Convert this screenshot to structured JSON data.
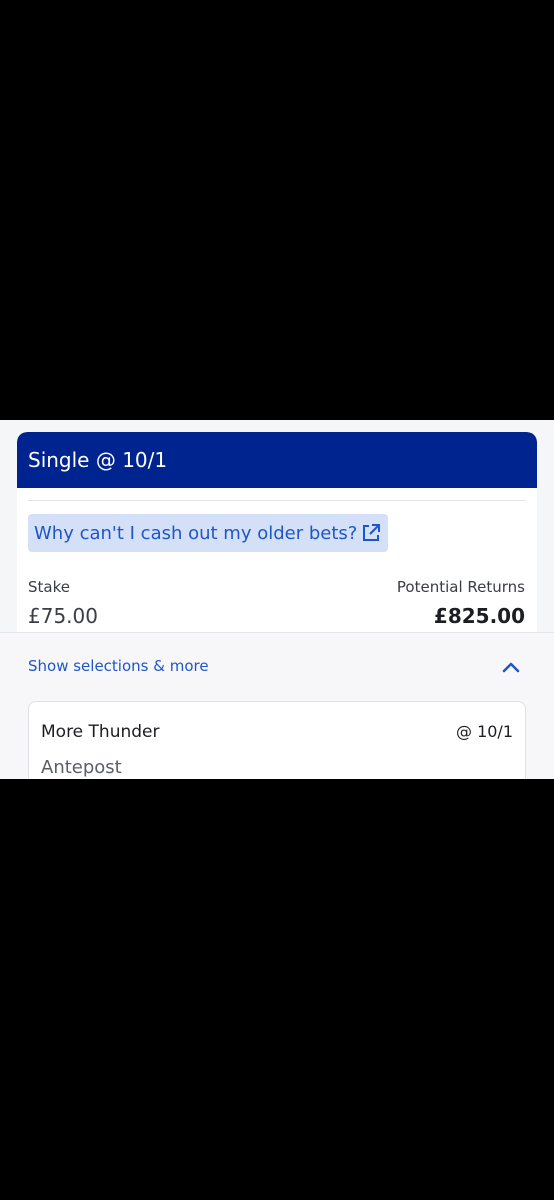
{
  "bet": {
    "title": "Single @ 10/1",
    "cashout_info_link": "Why can't I cash out my older bets?",
    "stake_label": "Stake",
    "stake_value": "£75.00",
    "returns_label": "Potential Returns",
    "returns_value": "£825.00"
  },
  "selections": {
    "toggle_label": "Show selections & more",
    "toggle_icon": "chevron-up-icon",
    "items": [
      {
        "name": "More Thunder",
        "odds": "@ 10/1",
        "market": "Antepost"
      }
    ]
  },
  "colors": {
    "header_bg": "#00248f",
    "link": "#1f56c7",
    "link_bg": "#d3e0f7",
    "letterbox": "#000000"
  }
}
